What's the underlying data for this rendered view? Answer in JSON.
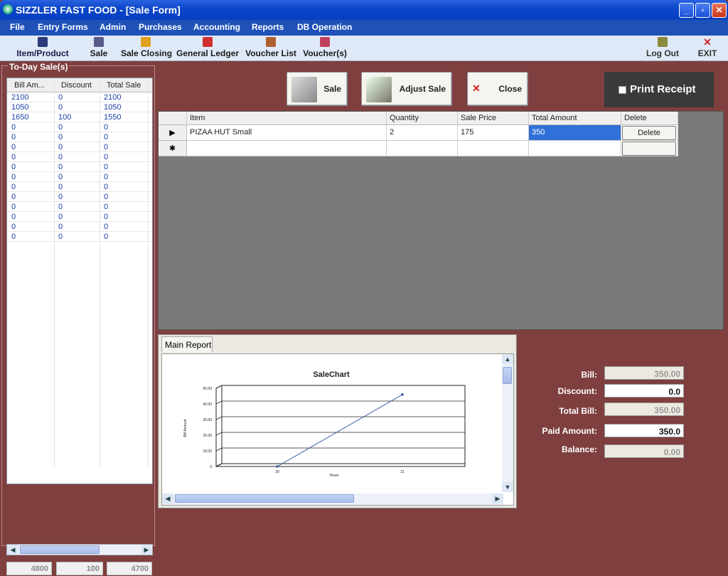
{
  "window": {
    "title": "SIZZLER FAST FOOD - [Sale Form]",
    "min": "_",
    "max": "▫",
    "close": "✕"
  },
  "menu": [
    "File",
    "Entry Forms",
    "Admin",
    "Purchases",
    "Accounting",
    "Reports",
    "DB Operation"
  ],
  "toolbar": {
    "items": [
      {
        "label": "Item/Product",
        "icon": "product-icon",
        "color": "#2a3a7a"
      },
      {
        "label": "Sale",
        "icon": "sale-icon",
        "color": "#5a5a8a"
      },
      {
        "label": "Sale Closing",
        "icon": "closing-icon",
        "color": "#e0a020"
      },
      {
        "label": "General Ledger",
        "icon": "ledger-icon",
        "color": "#d03030"
      },
      {
        "label": "Voucher List",
        "icon": "voucher-list-icon",
        "color": "#b06030"
      },
      {
        "label": "Voucher(s)",
        "icon": "vouchers-icon",
        "color": "#c04060"
      }
    ],
    "logout": {
      "label": "Log Out",
      "icon": "logout-icon",
      "color": "#8a8a40"
    },
    "exit": {
      "label": "EXIT",
      "icon": "exit-icon",
      "glyph": "✕",
      "color": "#d02020"
    }
  },
  "today_sales": {
    "legend": "To-Day Sale(s)",
    "headers": [
      "Bill Am...",
      "Discount",
      "Total Sale"
    ],
    "rows": [
      [
        "2100",
        "0",
        "2100"
      ],
      [
        "1050",
        "0",
        "1050"
      ],
      [
        "1650",
        "100",
        "1550"
      ],
      [
        "0",
        "0",
        "0"
      ],
      [
        "0",
        "0",
        "0"
      ],
      [
        "0",
        "0",
        "0"
      ],
      [
        "0",
        "0",
        "0"
      ],
      [
        "0",
        "0",
        "0"
      ],
      [
        "0",
        "0",
        "0"
      ],
      [
        "0",
        "0",
        "0"
      ],
      [
        "0",
        "0",
        "0"
      ],
      [
        "0",
        "0",
        "0"
      ],
      [
        "0",
        "0",
        "0"
      ],
      [
        "0",
        "0",
        "0"
      ],
      [
        "0",
        "0",
        "0"
      ]
    ],
    "totals": [
      "4800",
      "100",
      "4700"
    ]
  },
  "actions": {
    "sale": "Sale",
    "adjust": "Adjust Sale",
    "close": "Close",
    "print_receipt": "Print Receipt"
  },
  "grid": {
    "headers": [
      "Item",
      "Quantity",
      "Sale Price",
      "Total Amount",
      "Delete"
    ],
    "rows": [
      {
        "item": "PIZAA HUT Small",
        "quantity": "2",
        "price": "175",
        "total": "350",
        "delete": "Delete"
      }
    ],
    "current_row_marker": "▶",
    "new_row_marker": "✱"
  },
  "report": {
    "tab": "Main Report"
  },
  "chart_data": {
    "type": "line",
    "title": "SaleChart",
    "xlabel": "Hours",
    "ylabel": "Bill Amount",
    "x": [
      "20",
      "21"
    ],
    "y_ticks": [
      "0",
      "10.00",
      "20.00",
      "30.00",
      "40.00",
      "50.00"
    ],
    "ylim": [
      0,
      50
    ],
    "series": [
      {
        "values": [
          0,
          46
        ]
      }
    ]
  },
  "bill": {
    "bill_label": "Bill:",
    "bill": "350.00",
    "discount_label": "Discount:",
    "discount": "0.0",
    "total_label": "Total Bill:",
    "total": "350.00",
    "paid_label": "Paid Amount:",
    "paid": "350.0",
    "balance_label": "Balance:",
    "balance": "0.00"
  },
  "colors": {
    "accent": "#2a62e0",
    "form_bg": "#7f3f3f",
    "selected": "#3070d8"
  }
}
